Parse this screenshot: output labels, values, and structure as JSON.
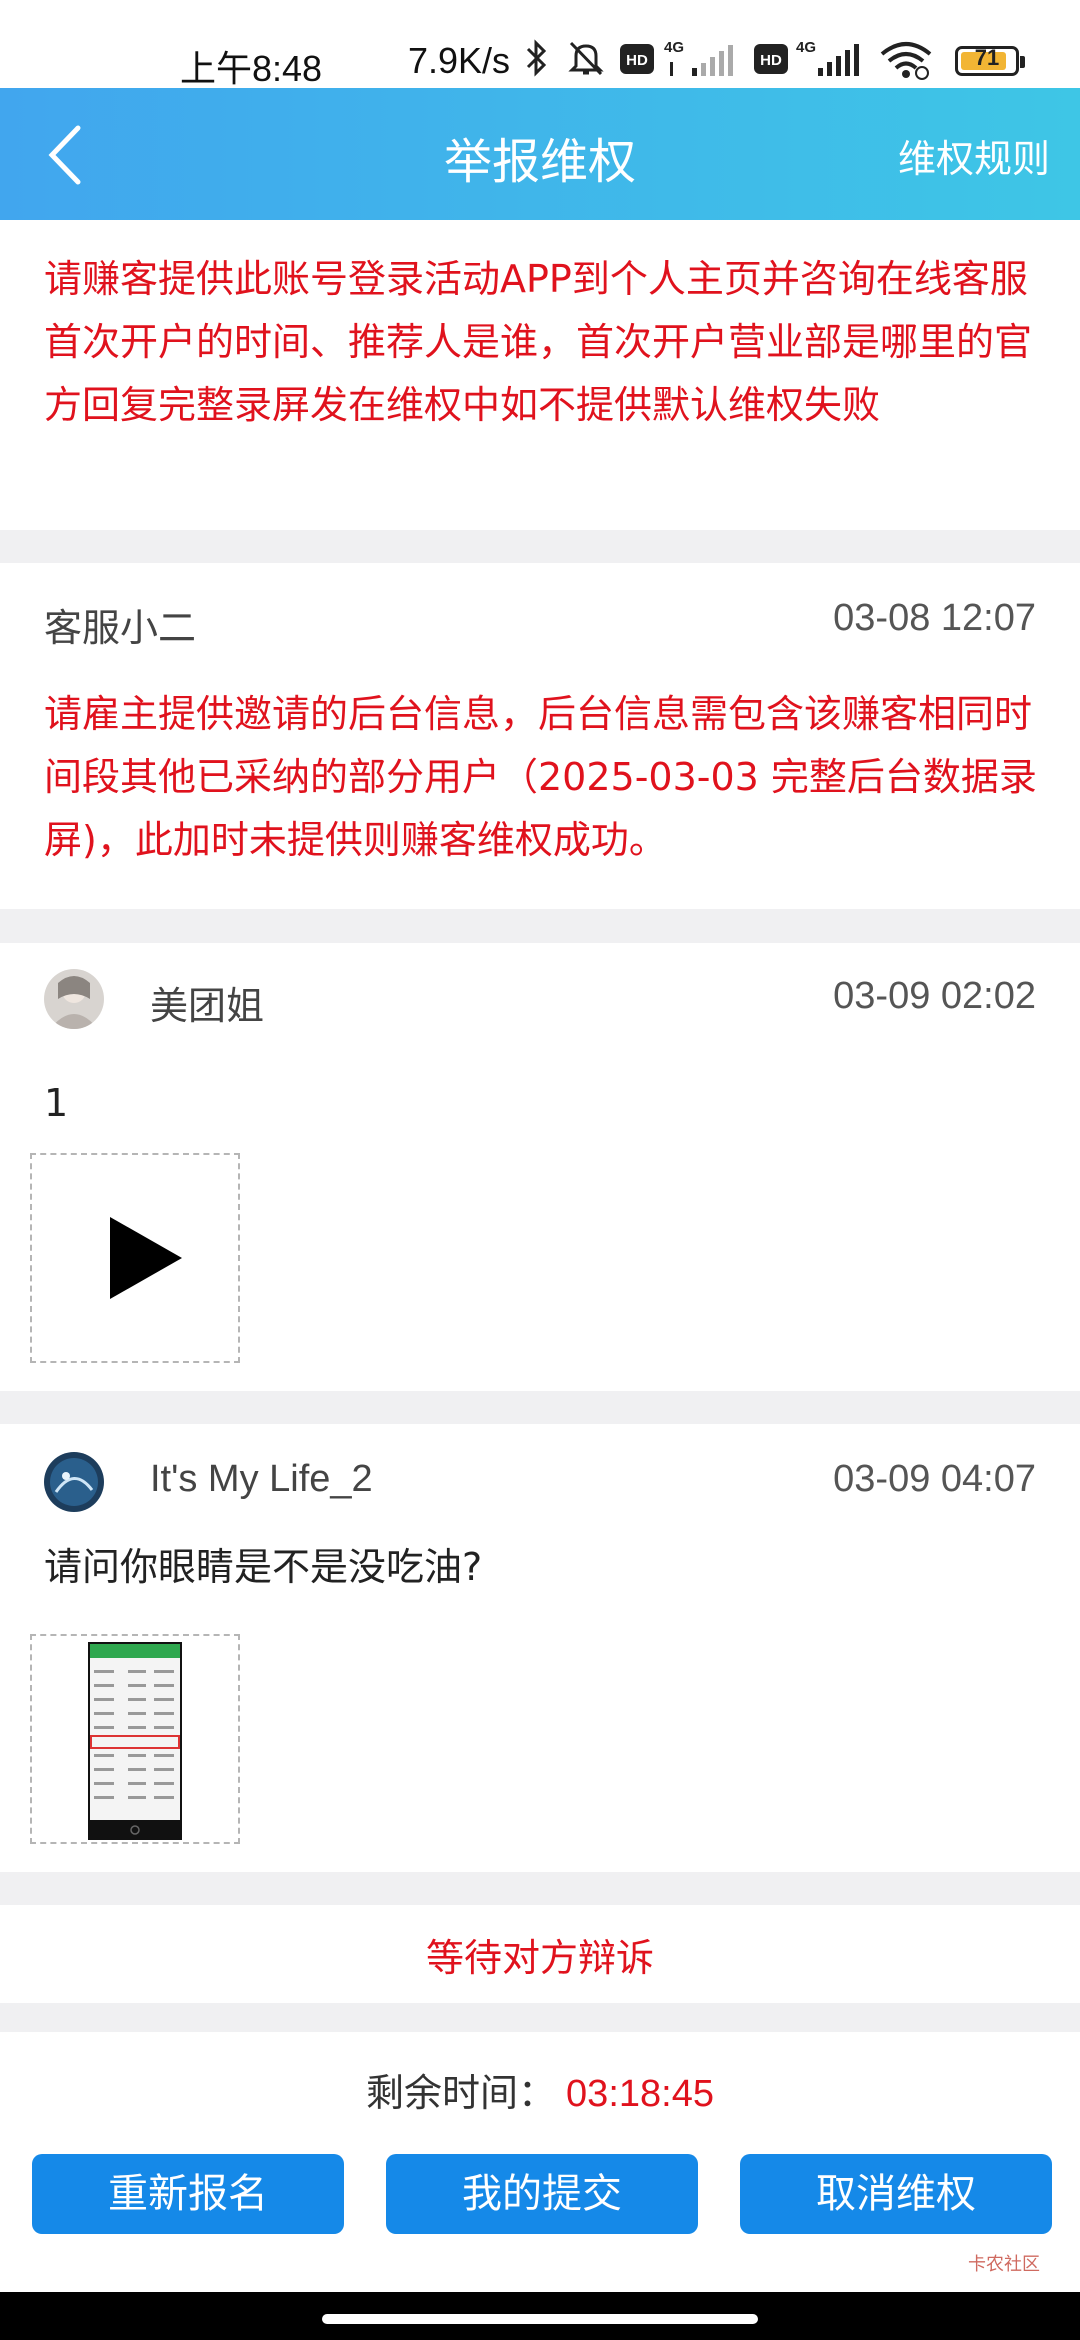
{
  "status_bar": {
    "time": "上午8:48",
    "speed": "7.9K/s",
    "battery": "71",
    "network1": "4G",
    "network2": "4G",
    "hd": "HD"
  },
  "header": {
    "title": "举报维权",
    "rules_link": "维权规则"
  },
  "notice": {
    "text": "请赚客提供此账号登录活动APP到个人主页并咨询在线客服首次开户的时间、推荐人是谁，首次开户营业部是哪里的官方回复完整录屏发在维权中如不提供默认维权失败"
  },
  "posts": [
    {
      "name": "客服小二",
      "date": "03-08 12:07",
      "text": "请雇主提供邀请的后台信息，后台信息需包含该赚客相同时间段其他已采纳的部分用户（2025-03-03 完整后台数据录屏)，此加时未提供则赚客维权成功。"
    },
    {
      "name": "美团姐",
      "date": "03-09 02:02",
      "text": "1"
    },
    {
      "name": "It's My Life_2",
      "date": "03-09 04:07",
      "text": "请问你眼睛是不是没吃油?"
    }
  ],
  "status": {
    "text": "等待对方辩诉"
  },
  "remaining": {
    "label": "剩余时间：",
    "value": "03:18:45"
  },
  "buttons": {
    "reapply": "重新报名",
    "my_submission": "我的提交",
    "cancel": "取消维权"
  },
  "watermark": "卡农社区",
  "colors": {
    "accent_red": "#e0121d",
    "button_blue": "#1589e8",
    "header_start": "#41a6ee",
    "header_end": "#3ec6e6"
  }
}
